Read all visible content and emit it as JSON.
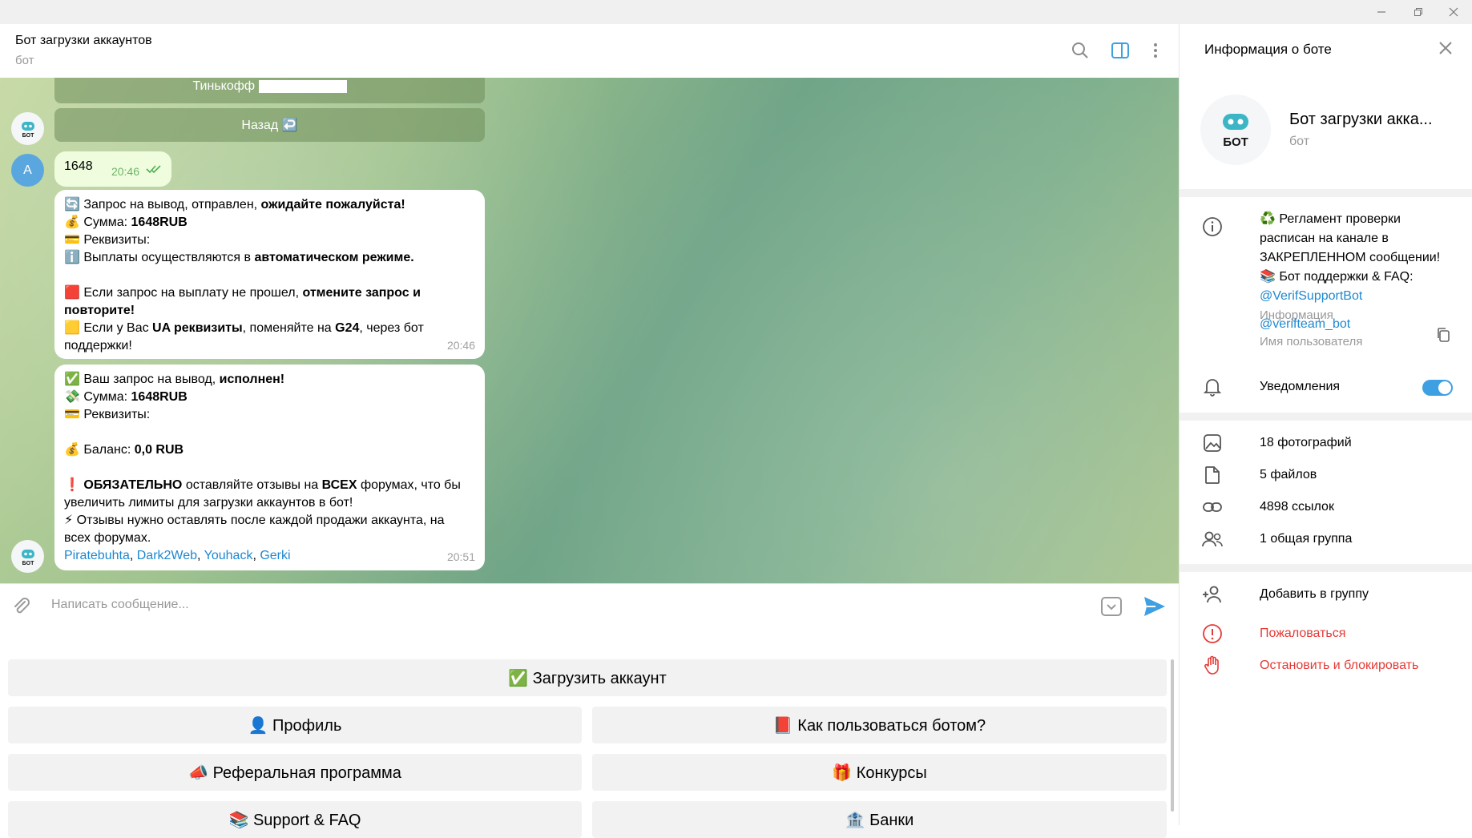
{
  "window": {
    "minimize_icon": "minimize-icon",
    "restore_icon": "restore-icon",
    "close_icon": "window-close-icon"
  },
  "chat": {
    "title": "Бот загрузки аккаунтов",
    "subtitle": "бот",
    "header_icons": [
      "search-icon",
      "sidebar-toggle-icon",
      "more-vertical-icon"
    ]
  },
  "messages": {
    "inline_buttons": [
      "Тинькофф",
      "Назад ↩️"
    ],
    "user_message": {
      "text": "1648",
      "time": "20:46",
      "avatar_letter": "A"
    },
    "bot_message_1": {
      "line1a": "🔄 Запрос на вывод,  отправлен, ",
      "line1b": "ожидайте пожалуйста!",
      "line2a": "💰 Сумма: ",
      "line2b": "1648RUB",
      "line3": "💳 Реквизиты: ",
      "line4a": "ℹ️ Выплаты осуществляются в ",
      "line4b": "автоматическом режиме.",
      "line5a": "🟥 Если запрос на выплату не прошел, ",
      "line5b": "отмените запрос и",
      "line6": "повторите!",
      "line7a": "🟨 Если у Вас ",
      "line7b": "UA реквизиты",
      "line7c": ", поменяйте на ",
      "line7d": "G24",
      "line7e": ", через бот",
      "line8": "поддержки!",
      "time": "20:46"
    },
    "bot_message_2": {
      "line1a": "✅ Ваш запрос на вывод, ",
      "line1b": "исполнен!",
      "line2a": "💸 Сумма: ",
      "line2b": "1648RUB",
      "line3": "💳 Реквизиты: ",
      "line4a": "💰 Баланс: ",
      "line4b": "0,0 RUB",
      "line5a": "❗ ",
      "line5b": "ОБЯЗАТЕЛЬНО",
      "line5c": " оставляйте отзывы на ",
      "line5d": "ВСЕХ",
      "line5e": " форумах, что бы",
      "line6": "увеличить лимиты для загрузки аккаунтов в бот!",
      "line7": "⚡ Отзывы нужно оставлять после каждой продажи аккаунта, на",
      "line8": "всех форумах.",
      "links": [
        "Piratebuhta",
        "Dark2Web",
        "Youhack",
        "Gerki"
      ],
      "time": "20:51"
    }
  },
  "input": {
    "placeholder": "Написать сообщение..."
  },
  "keyboard": {
    "upload": "✅ Загрузить аккаунт",
    "profile": "👤 Профиль",
    "howto": "📕 Как пользоваться ботом?",
    "referral": "📣 Реферальная программа",
    "contests": "🎁 Конкурсы",
    "support": "📚 Support & FAQ",
    "banks": "🏦 Банки"
  },
  "panel": {
    "title": "Информация о боте",
    "name": "Бот загрузки акка...",
    "subtitle": "бот",
    "about_1": "♻️ Регламент проверки",
    "about_2": "расписан на канале в",
    "about_3": "ЗАКРЕПЛЕННОМ сообщении!",
    "about_4": "📚 Бот поддержки & FAQ:",
    "about_link": "@VerifSupportBot",
    "about_caption": "Информация",
    "username": "@verifteam_bot",
    "username_caption": "Имя пользователя",
    "notifications": "Уведомления",
    "notifications_on": true,
    "photos": "18 фотографий",
    "files": "5 файлов",
    "links": "4898 ссылок",
    "groups": "1 общая группа",
    "add_to_group": "Добавить в группу",
    "report": "Пожаловаться",
    "block": "Остановить и блокировать"
  },
  "colors": {
    "accent": "#3ea0e2",
    "danger": "#e53935",
    "outgoing_bubble": "#effdde"
  }
}
